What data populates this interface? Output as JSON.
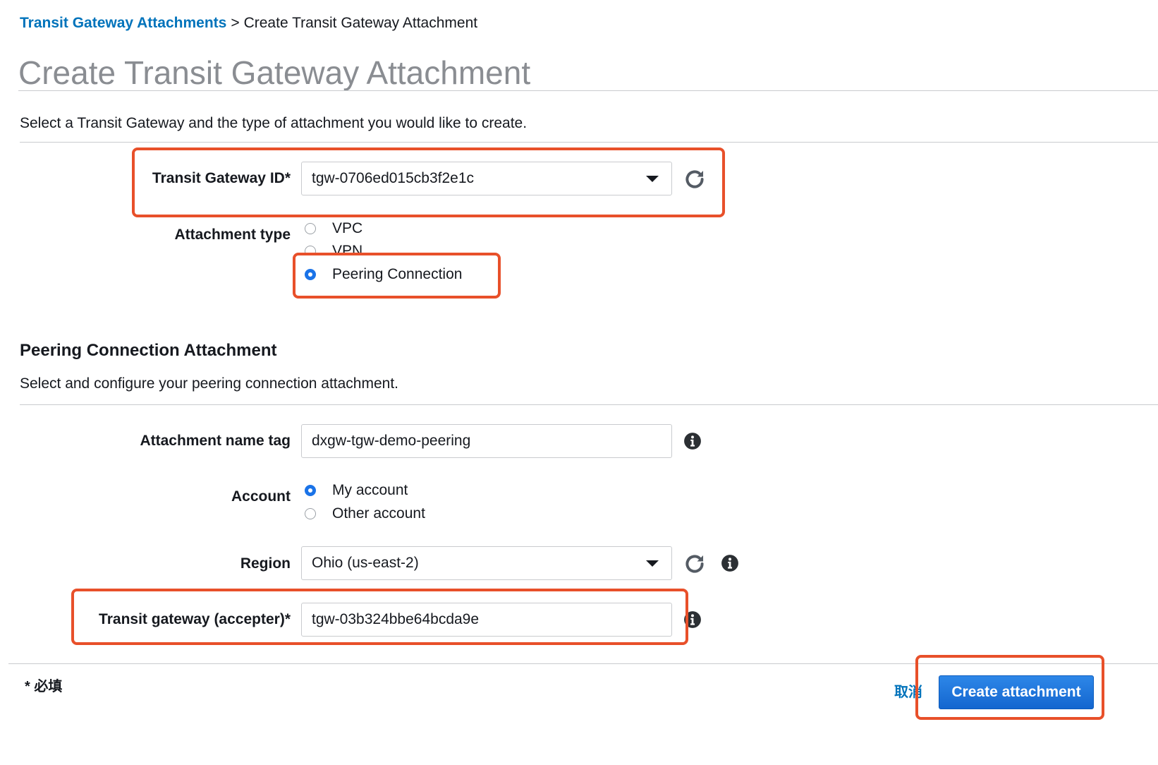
{
  "breadcrumb": {
    "parent": "Transit Gateway Attachments",
    "separator": ">",
    "current": "Create Transit Gateway Attachment"
  },
  "page_title": "Create Transit Gateway Attachment",
  "intro": "Select a Transit Gateway and the type of attachment you would like to create.",
  "transit_gateway": {
    "label": "Transit Gateway ID*",
    "value": "tgw-0706ed015cb3f2e1c"
  },
  "attachment_type": {
    "label": "Attachment type",
    "options": [
      {
        "label": "VPC",
        "selected": false
      },
      {
        "label": "VPN",
        "selected": false
      },
      {
        "label": "Peering Connection",
        "selected": true
      }
    ]
  },
  "peering_section": {
    "title": "Peering Connection Attachment",
    "description": "Select and configure your peering connection attachment.",
    "name_tag": {
      "label": "Attachment name tag",
      "value": "dxgw-tgw-demo-peering"
    },
    "account": {
      "label": "Account",
      "options": [
        {
          "label": "My account",
          "selected": true
        },
        {
          "label": "Other account",
          "selected": false
        }
      ]
    },
    "region": {
      "label": "Region",
      "value": "Ohio (us-east-2)"
    },
    "accepter": {
      "label": "Transit gateway (accepter)*",
      "value": "tgw-03b324bbe64bcda9e"
    }
  },
  "footer": {
    "required_note": "* 必填",
    "cancel_label": "取消",
    "create_label": "Create attachment"
  },
  "colors": {
    "link": "#0073bb",
    "primary": "#1a73e8",
    "highlight": "#e8502a",
    "title_gray": "#8a8d92"
  },
  "icons": [
    "caret-down-icon",
    "refresh-icon",
    "info-icon"
  ]
}
